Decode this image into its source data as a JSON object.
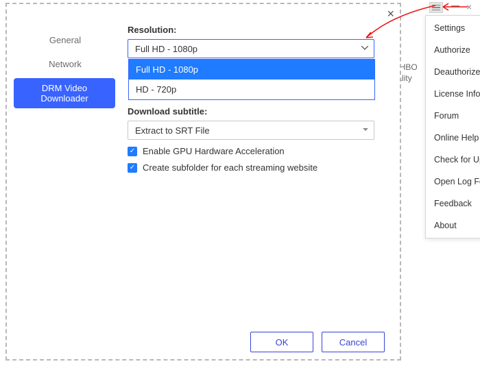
{
  "sidebar": {
    "items": [
      {
        "label": "General"
      },
      {
        "label": "Network"
      },
      {
        "label": "DRM Video Downloader"
      }
    ]
  },
  "panel": {
    "resolution_label": "Resolution:",
    "resolution_value": "Full HD - 1080p",
    "resolution_options": [
      "Full HD - 1080p",
      "HD - 720p"
    ],
    "subtitle_label": "Download subtitle:",
    "subtitle_value": "Extract to SRT File",
    "check_gpu": "Enable GPU Hardware Acceleration",
    "check_subfolder": "Create subfolder for each streaming website"
  },
  "footer": {
    "ok": "OK",
    "cancel": "Cancel"
  },
  "bg": {
    "line1": "deo, HBO",
    "line2": "o quality"
  },
  "menu": {
    "items": [
      "Settings",
      "Authorize",
      "Deauthorize",
      "License Info",
      "Forum",
      "Online Help",
      "Check for Updates",
      "Open Log Folder",
      "Feedback",
      "About"
    ]
  }
}
